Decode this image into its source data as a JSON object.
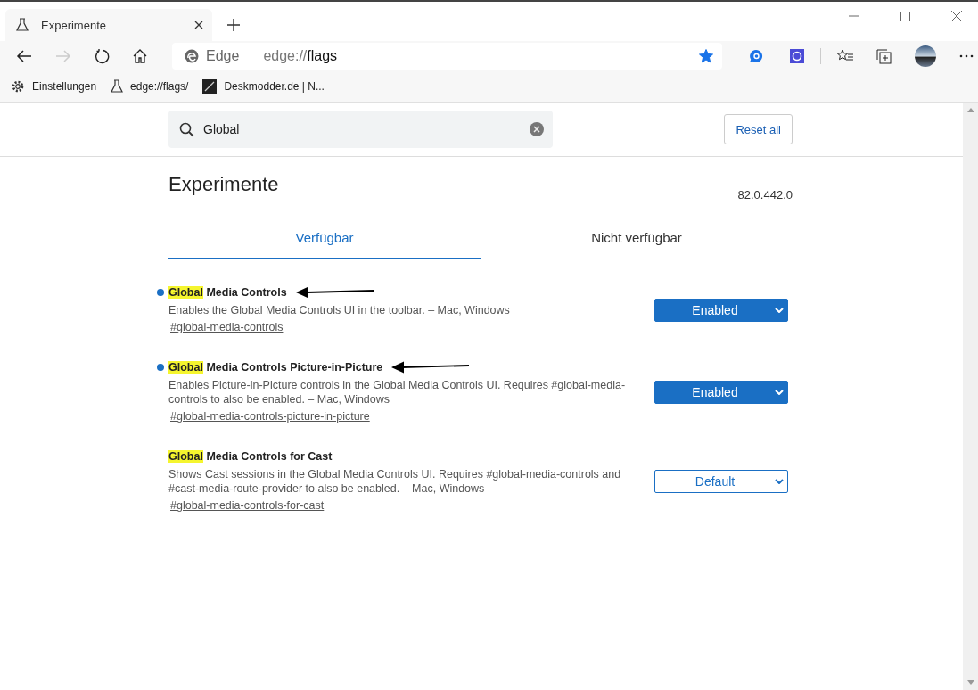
{
  "browser": {
    "tab": {
      "title": "Experimente"
    },
    "address": {
      "site": "Edge",
      "url_prefix": "edge://",
      "url_main": "flags",
      "favorite": true
    },
    "bookmarks": [
      {
        "label": "Einstellungen",
        "kind": "gear"
      },
      {
        "label": "edge://flags/",
        "kind": "flask"
      },
      {
        "label": "Deskmodder.de | N...",
        "kind": "site"
      }
    ]
  },
  "search": {
    "value": "Global"
  },
  "reset_button": "Reset all",
  "page": {
    "title": "Experimente",
    "version": "82.0.442.0"
  },
  "tabs": [
    {
      "label": "Verfügbar",
      "selected": true
    },
    {
      "label": "Nicht verfügbar",
      "selected": false
    }
  ],
  "flags": [
    {
      "title_match": "Global",
      "title_rest": " Media Controls",
      "modified": true,
      "annotated": true,
      "description": "Enables the Global Media Controls UI in the toolbar. – Mac, Windows",
      "link": "#global-media-controls",
      "value": "Enabled",
      "kind": "enabled"
    },
    {
      "title_match": "Global",
      "title_rest": " Media Controls Picture-in-Picture",
      "modified": true,
      "annotated": true,
      "description": "Enables Picture-in-Picture controls in the Global Media Controls UI. Requires #global-media-controls to also be enabled. – Mac, Windows",
      "link": "#global-media-controls-picture-in-picture",
      "value": "Enabled",
      "kind": "enabled"
    },
    {
      "title_match": "Global",
      "title_rest": " Media Controls for Cast",
      "modified": false,
      "annotated": false,
      "description": "Shows Cast sessions in the Global Media Controls UI. Requires #global-media-controls and #cast-media-route-provider to also be enabled. – Mac, Windows",
      "link": "#global-media-controls-for-cast",
      "value": "Default",
      "kind": "default"
    }
  ]
}
